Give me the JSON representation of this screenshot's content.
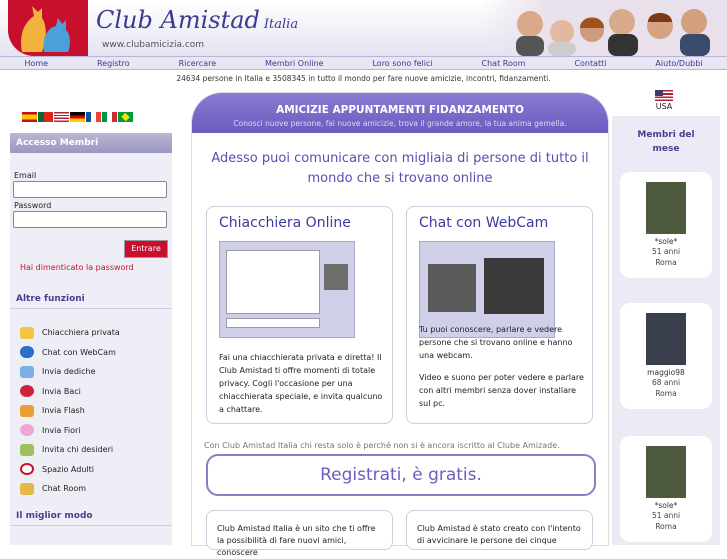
{
  "header": {
    "title": "Club Amistad",
    "title_suffix": "Italia",
    "url": "www.clubamicizia.com"
  },
  "nav": [
    "Home",
    "Registro",
    "Ricercare",
    "Membri Online",
    "Loro sono felici",
    "Chat Room",
    "Contatti",
    "Aiuto/Dubbi"
  ],
  "counter": "24634 persone in Italia e 3508345 in tutto il mondo per fare nuove amicizie, incontri, fidanzamenti.",
  "lang": {
    "us": "USA"
  },
  "login": {
    "title": "Accesso Membri",
    "email_label": "Email",
    "password_label": "Password",
    "submit": "Entrare",
    "forgot": "Hai dimenticato la password"
  },
  "functions": {
    "title": "Altre funzioni",
    "items": [
      "Chiacchiera privata",
      "Chat con WebCam",
      "Invia dediche",
      "Invia Baci",
      "Invia Flash",
      "Invia Fiori",
      "Invita chi desideri",
      "Spazio Adulti",
      "Chat Room"
    ]
  },
  "best": {
    "title": "Il miglior modo"
  },
  "banner": {
    "title": "AMICIZIE APPUNTAMENTI FIDANZAMENTO",
    "subtitle": "Conosci nuove persone, fai nuove amicizie, trova il grande amore, la tua anima gemella."
  },
  "lead": "Adesso puoi comunicare con migliaia di persone di tutto il mondo che si trovano online",
  "box1": {
    "title": "Chiacchiera Online",
    "text": "Fai una chiacchierata privata e diretta! Il Club Amistad ti offre momenti di totale privacy. Cogli l'occasione per una chiacchierata speciale, e invita qualcuno a chattare."
  },
  "box2": {
    "title": "Chat con WebCam",
    "text1": "Tu puoi conoscere, parlare e vedere persone che si trovano online e hanno una webcam.",
    "text2": "Video e suono per poter vedere e parlare con altri membri senza dover installare sul pc."
  },
  "note": "Con Club Amistad Italia chi resta solo è perché non si è ancora iscritto al Clube Amizade.",
  "register": "Registrati, è gratis.",
  "bottom": {
    "left": "Club Amistad Italia è un sito che ti offre la possibilità di fare nuovi amici, conoscere",
    "right": "Club Amistad è stato creato con l'intento di avvicinare le persone dei cinque"
  },
  "members": {
    "title": "Membri del mese",
    "list": [
      {
        "name": "*sole*",
        "age": "51 anni",
        "city": "Roma"
      },
      {
        "name": "maggio98",
        "age": "68 anni",
        "city": "Roma"
      },
      {
        "name": "*sole*",
        "age": "51 anni",
        "city": "Roma"
      }
    ]
  }
}
